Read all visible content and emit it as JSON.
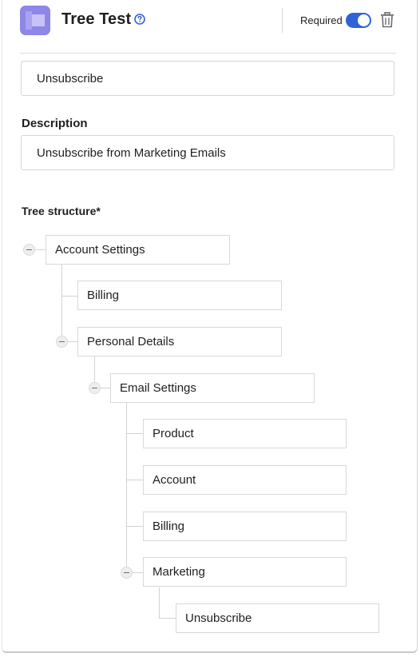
{
  "header": {
    "title": "Tree Test",
    "required_label": "Required",
    "required_on": true,
    "accent_color": "#2f63d8",
    "icon_color": "#8e86e8",
    "icons": [
      "tree-test-icon",
      "help-icon",
      "trash-icon"
    ]
  },
  "question": {
    "value": "Unsubscribe"
  },
  "description": {
    "label": "Description",
    "value": "Unsubscribe from Marketing Emails"
  },
  "tree": {
    "label": "Tree structure*",
    "nodes": {
      "account_settings": "Account Settings",
      "billing_top": "Billing",
      "personal_details": "Personal Details",
      "email_settings": "Email Settings",
      "product": "Product",
      "account": "Account",
      "billing_email": "Billing",
      "marketing": "Marketing",
      "unsubscribe": "Unsubscribe"
    }
  }
}
